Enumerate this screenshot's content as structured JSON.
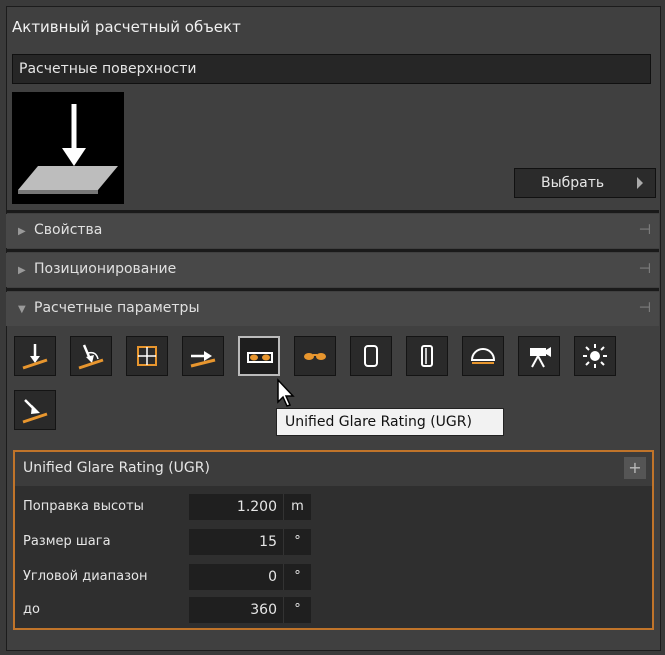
{
  "header": {
    "title": "Активный расчетный объект"
  },
  "surface": {
    "label": "Расчетные поверхности"
  },
  "select_button": {
    "label": "Выбрать"
  },
  "sections": [
    {
      "label": "Свойства",
      "expanded": false
    },
    {
      "label": "Позиционирование",
      "expanded": false
    },
    {
      "label": "Расчетные параметры",
      "expanded": true
    }
  ],
  "toolbar": {
    "tools": [
      "illuminance-icon",
      "angled-illuminance-icon",
      "grid-icon",
      "horizontal-illuminance-icon",
      "ugr-glasses-icon",
      "glasses-icon",
      "cylinder-icon",
      "half-cylinder-icon",
      "hemisphere-icon",
      "camera-icon",
      "sun-icon",
      "diagonal-illuminance-icon"
    ],
    "active_index": 4,
    "accent_color": "#e8962e"
  },
  "tooltip": {
    "text": "Unified Glare Rating (UGR)"
  },
  "ugr_panel": {
    "title": "Unified Glare Rating (UGR)",
    "add_label": "+",
    "rows": [
      {
        "label": "Поправка высоты",
        "value": "1.200",
        "unit": "m"
      },
      {
        "label": "Размер шага",
        "value": "15",
        "unit": "°"
      },
      {
        "label": "Угловой диапазон",
        "value": "0",
        "unit": "°"
      },
      {
        "label": "до",
        "value": "360",
        "unit": "°"
      }
    ],
    "border_color": "#c0742a"
  }
}
